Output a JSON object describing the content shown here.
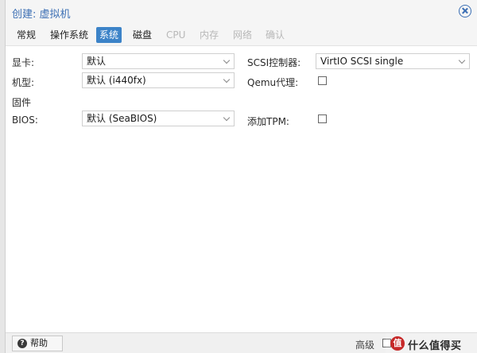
{
  "window": {
    "title": "创建: 虚拟机"
  },
  "tabs": [
    {
      "label": "常规",
      "state": "normal"
    },
    {
      "label": "操作系统",
      "state": "normal"
    },
    {
      "label": "系统",
      "state": "active"
    },
    {
      "label": "磁盘",
      "state": "normal"
    },
    {
      "label": "CPU",
      "state": "disabled"
    },
    {
      "label": "内存",
      "state": "disabled"
    },
    {
      "label": "网络",
      "state": "disabled"
    },
    {
      "label": "确认",
      "state": "disabled"
    }
  ],
  "form": {
    "graphics": {
      "label": "显卡:",
      "value": "默认"
    },
    "machine": {
      "label": "机型:",
      "value": "默认 (i440fx)"
    },
    "firmware_section": {
      "label": "固件"
    },
    "bios": {
      "label": "BIOS:",
      "value": "默认 (SeaBIOS)"
    },
    "scsi": {
      "label": "SCSI控制器:",
      "value": "VirtIO SCSI single"
    },
    "qemu_agent": {
      "label": "Qemu代理:",
      "checked": false
    },
    "tpm": {
      "label": "添加TPM:",
      "checked": false
    }
  },
  "footer": {
    "help_label": "帮助",
    "advanced_label": "高级",
    "advanced_checked": false,
    "watermark_text": "什么值得买"
  },
  "colors": {
    "accent": "#3c83c8",
    "title": "#3c6fb4"
  }
}
